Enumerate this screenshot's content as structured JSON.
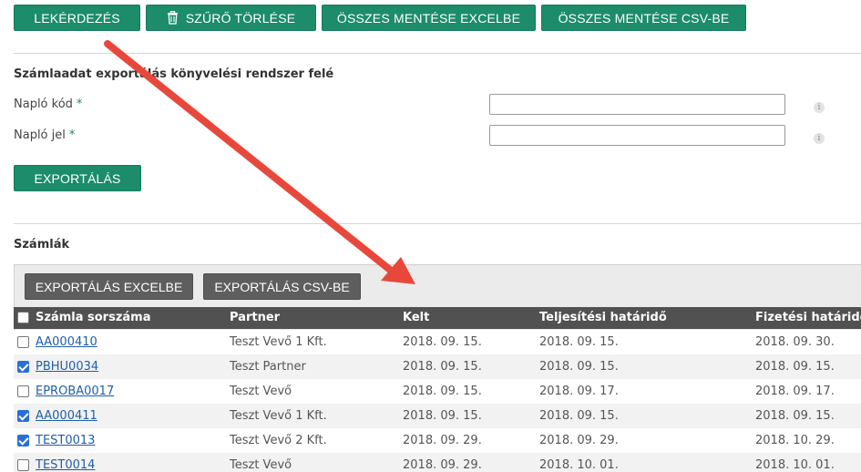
{
  "toolbar": {
    "query_label": "LEKÉRDEZÉS",
    "clear_filter_label": "SZŰRŐ TÖRLÉSE",
    "save_all_excel_label": "ÖSSZES MENTÉSE EXCELBE",
    "save_all_csv_label": "ÖSSZES MENTÉSE CSV-BE"
  },
  "export_section": {
    "title": "Számlaadat exportálás könyvelési rendszer felé",
    "journal_code_label": "Napló kód",
    "journal_code_value": "",
    "journal_sign_label": "Napló jel",
    "journal_sign_value": "",
    "required_mark": "*",
    "info_glyph": "i",
    "export_button_label": "EXPORTÁLÁS"
  },
  "invoices": {
    "title": "Számlák",
    "export_excel_label": "EXPORTÁLÁS EXCELBE",
    "export_csv_label": "EXPORTÁLÁS CSV-BE",
    "columns": [
      "Számla sorszáma",
      "Partner",
      "Kelt",
      "Teljesítési határidő",
      "Fizetési határidő"
    ],
    "rows": [
      {
        "number": "AA000410",
        "partner": "Teszt Vevő 1 Kft.",
        "issued": "2018. 09. 15.",
        "fulfillment": "2018. 09. 15.",
        "payment": "2018. 09. 30.",
        "checked": false
      },
      {
        "number": "PBHU0034",
        "partner": "Teszt Partner",
        "issued": "2018. 09. 15.",
        "fulfillment": "2018. 09. 15.",
        "payment": "2018. 09. 15.",
        "checked": true
      },
      {
        "number": "EPROBA0017",
        "partner": "Teszt Vevő",
        "issued": "2018. 09. 15.",
        "fulfillment": "2018. 09. 17.",
        "payment": "2018. 09. 17.",
        "checked": false
      },
      {
        "number": "AA000411",
        "partner": "Teszt Vevő 1 Kft.",
        "issued": "2018. 09. 15.",
        "fulfillment": "2018. 09. 15.",
        "payment": "2018. 09. 15.",
        "checked": true
      },
      {
        "number": "TEST0013",
        "partner": "Teszt Vevő 2 Kft.",
        "issued": "2018. 09. 29.",
        "fulfillment": "2018. 09. 29.",
        "payment": "2018. 10. 29.",
        "checked": true
      },
      {
        "number": "TEST0014",
        "partner": "Teszt Vevő",
        "issued": "2018. 09. 29.",
        "fulfillment": "2018. 10. 01.",
        "payment": "2018. 10. 01.",
        "checked": false
      }
    ]
  },
  "icons": {
    "trash": "trash-icon",
    "arrow": "annotation-arrow-icon"
  },
  "colors": {
    "primary_green": "#1c8c6a",
    "dark_gray": "#5e5e5e",
    "header_gray": "#515151",
    "link_blue": "#1f5fa6",
    "arrow_red": "#e8483c",
    "checkbox_blue": "#2a6fd6"
  }
}
